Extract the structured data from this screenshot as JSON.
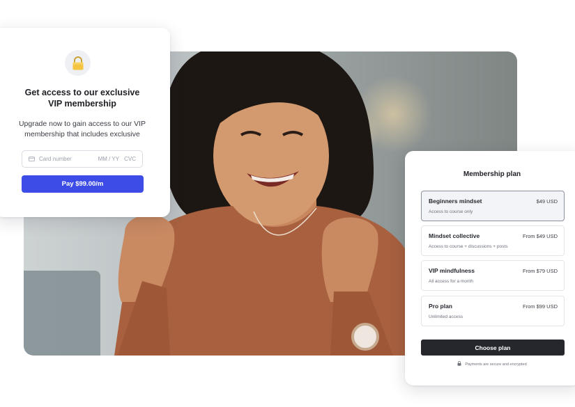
{
  "vip_card": {
    "icon": "lock-icon",
    "title_line1": "Get access to our exclusive",
    "title_line2": "VIP membership",
    "desc_line1": "Upgrade now to gain access to our VIP",
    "desc_line2": "membership that includes exclusive",
    "card_number_placeholder": "Card number",
    "expiry_placeholder": "MM / YY",
    "cvc_placeholder": "CVC",
    "pay_label": "Pay $99.00/m",
    "accent": "#3d4ce6"
  },
  "plan_card": {
    "title": "Membership plan",
    "plans": [
      {
        "name": "Beginners mindset",
        "price": "$49 USD",
        "desc": "Access to course only",
        "selected": true
      },
      {
        "name": "Mindset collective",
        "price": "From $49 USD",
        "desc": "Access to course + discussions + posts",
        "selected": false
      },
      {
        "name": "VIP mindfulness",
        "price": "From $79 USD",
        "desc": "All access for a month",
        "selected": false
      },
      {
        "name": "Pro plan",
        "price": "From $99 USD",
        "desc": "Unlimited access",
        "selected": false
      }
    ],
    "choose_label": "Choose plan",
    "secure_note": "Payments are secure and encrypted",
    "button_color": "#25272c"
  },
  "photo": {
    "subject": "celebrating-woman-photo"
  }
}
